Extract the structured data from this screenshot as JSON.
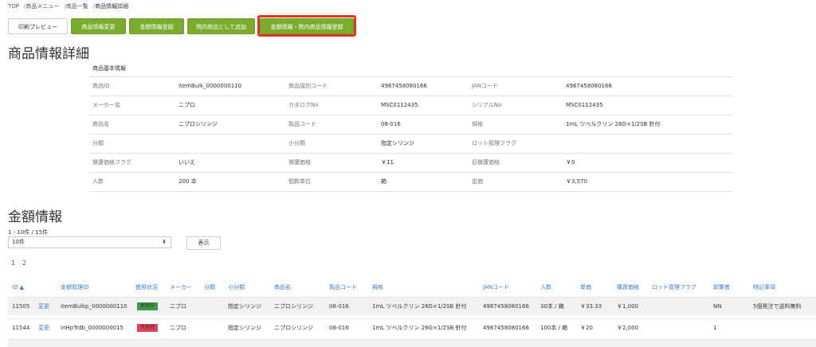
{
  "breadcrumb": {
    "items": [
      "TOP",
      "商品メニュー",
      "商品一覧"
    ],
    "current": "商品情報詳細",
    "separator": "/"
  },
  "toolbar": {
    "print_preview": "印刷プレビュー",
    "edit_product": "商品情報変更",
    "register_price": "金額情報登録",
    "add_inhouse": "院内商品として追加",
    "register_price_inhouse": "金額情報・院内商品情報登録"
  },
  "colors": {
    "accent_green": "#7aad2e",
    "highlight_red": "#e8321c",
    "link_blue": "#3a7bd5",
    "badge_green": "#3b9b47",
    "badge_red": "#e0405a"
  },
  "detail": {
    "title": "商品情報詳細",
    "section_label": "商品基本情報",
    "rows": [
      {
        "l1": "商品ID",
        "v1": "itemBulk_0000000110",
        "l2": "商品識別コード",
        "v2": "4987458080166",
        "l3": "JANコード",
        "v3": "4987458080166"
      },
      {
        "l1": "メーカー名",
        "v1": "ニプロ",
        "l2": "カタログNo",
        "v2": "MSC0112435",
        "l3": "シリアルNo",
        "v3": "MSC0112435"
      },
      {
        "l1": "商品名",
        "v1": "ニプロシリンジ",
        "l2": "製品コード",
        "v2": "08-016",
        "l3": "規格",
        "v3": "1mL ツベルクリン 26G×1/2SB 針付"
      },
      {
        "l1": "分類",
        "v1": "",
        "l2": "小分類",
        "v2": "指定シリンジ",
        "l3": "ロット管理フラグ",
        "v3": ""
      },
      {
        "l1": "償還価格フラグ",
        "v1": "いいえ",
        "l2": "償還価格",
        "v2": "￥11",
        "l3": "旧償還価格",
        "v3": "￥0"
      },
      {
        "l1": "入数",
        "v1": "200 本",
        "l2": "個数単位",
        "v2": "箱",
        "l3": "定価",
        "v3": "￥3,570"
      }
    ]
  },
  "price": {
    "title": "金額情報",
    "count_text": "1 - 10件 / 15件",
    "per_page": "10件",
    "show_button": "表示",
    "pages": [
      "1",
      "2"
    ],
    "columns": {
      "id": "ID ▲",
      "mgmt_id": "金額管理ID",
      "status": "使用状況",
      "maker": "メーカー",
      "category": "分類",
      "subcategory": "小分類",
      "name": "商品名",
      "product_code": "製品コード",
      "spec": "規格",
      "jan": "JANコード",
      "qty": "入数",
      "unit_price": "単価",
      "purchase_price": "購買価格",
      "lot_flag": "ロット管理フラグ",
      "vendor": "卸業者",
      "notes": "特記事項"
    },
    "rows": [
      {
        "id": "11505",
        "edit": "変更",
        "mgmt_id": "itemBulkp_0000000110",
        "status": "使用中",
        "maker": "ニプロ",
        "subcategory": "指定シリンジ",
        "name": "ニプロシリンジ",
        "product_code": "08-016",
        "spec": "1mL ツベルクリン 26G×1/2SB 針付",
        "jan": "4987458080166",
        "qty": "30本 / 箱",
        "unit_price": "￥33.33",
        "purchase_price": "￥1,000",
        "vendor": "NN",
        "notes": "5個発注で送料無料"
      },
      {
        "id": "11544",
        "edit": "変更",
        "mgmt_id": "inHpTrdb_0000000015",
        "status": "不使用",
        "maker": "ニプロ",
        "subcategory": "指定シリンジ",
        "name": "ニプロシリンジ",
        "product_code": "08-016",
        "spec": "1mL ツベルクリン 26G×1/2SB 針付",
        "jan": "4987458080166",
        "qty": "100本 / 箱",
        "unit_price": "￥20",
        "purchase_price": "￥2,000",
        "vendor": "1",
        "notes": ""
      }
    ]
  }
}
